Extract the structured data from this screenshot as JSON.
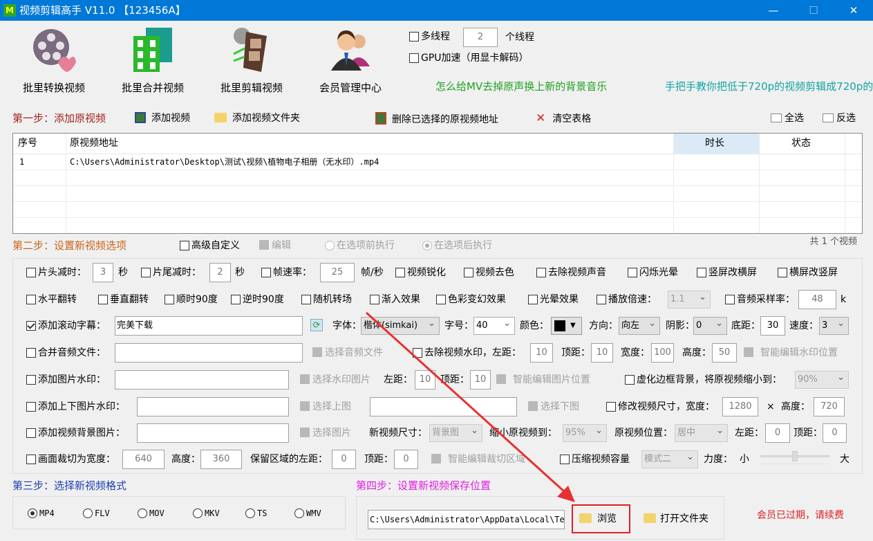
{
  "window": {
    "title": "视频剪辑高手 V11.0 【123456A】",
    "minimize": "—",
    "maximize": "☐",
    "close": "✕",
    "accent": "#0078d7"
  },
  "toolbar": {
    "items": [
      {
        "label": "批里转换视频",
        "icon": "film-reel-convert-icon"
      },
      {
        "label": "批里合并视频",
        "icon": "film-merge-icon"
      },
      {
        "label": "批里剪辑视频",
        "icon": "film-strip-cut-icon"
      },
      {
        "label": "会员管理中心",
        "icon": "users-icon"
      }
    ],
    "multithread_label": "多线程",
    "thread_count": "2",
    "thread_unit": "个线程",
    "gpu_label": "GPU加速（用显卡解码）",
    "link1": "怎么给MV去掉原声换上新的背景音乐",
    "link2": "手把手教你把低于720p的视频剪辑成720p的"
  },
  "step1": {
    "label": "第一步：添加原视频",
    "add_video": "添加视频",
    "add_folder": "添加视频文件夹",
    "delete_selected": "删除已选择的原视频地址",
    "clear": "清空表格",
    "select_all": "全选",
    "invert": "反选"
  },
  "table": {
    "columns": [
      "序号",
      "原视频地址",
      "时长",
      "状态"
    ],
    "rows": [
      {
        "index": "1",
        "path": "C:\\Users\\Administrator\\Desktop\\测试\\视频\\植物电子相册（无水印）.mp4",
        "duration": "",
        "status": ""
      }
    ]
  },
  "step2": {
    "label": "第二步：设置新视频选项",
    "advanced": "高级自定义",
    "edit": "编辑",
    "before": "在选项前执行",
    "after": "在选项后执行",
    "count": "共 1 个视频"
  },
  "opts": {
    "r1": {
      "head": "片头减时：",
      "head_v": "3",
      "sec": "秒",
      "tail": "片尾减时：",
      "tail_v": "2",
      "fps": "帧速率：",
      "fps_v": "25",
      "fps_unit": "帧/秒",
      "sharpen": "视频锐化",
      "decolor": "视频去色",
      "mute": "去除视频声音",
      "flash": "闪烁光晕",
      "v2h": "竖屏改横屏",
      "h2v": "横屏改竖屏"
    },
    "r2": {
      "hflip": "水平翻转",
      "vflip": "垂直翻转",
      "cw": "顺时90度",
      "ccw": "逆时90度",
      "trans": "随机转场",
      "fadein": "渐入效果",
      "color": "色彩变幻效果",
      "halo": "光晕效果",
      "speed": "播放倍速：",
      "speed_v": "1.1",
      "rate": "音频采样率：",
      "rate_v": "48",
      "rate_unit": "k"
    },
    "r3": {
      "scroll": "添加滚动字幕：",
      "scroll_v": "完美下载",
      "font": "字体：",
      "font_v": "楷体(simkai)",
      "size": "字号：",
      "size_v": "40",
      "color": "颜色：",
      "color_v": "#000000",
      "dir": "方向：",
      "dir_v": "向左",
      "shadow": "阴影：",
      "shadow_v": "0",
      "bottom": "底距：",
      "bottom_v": "30",
      "spd": "速度：",
      "spd_v": "3"
    },
    "r4": {
      "audio": "合并音频文件：",
      "audio_v": "",
      "pick_audio": "选择音频文件",
      "rmwm": "去除视频水印，左距：",
      "l_v": "10",
      "top": "顶距：",
      "t_v": "10",
      "w": "宽度：",
      "w_v": "100",
      "h": "高度：",
      "h_v": "50",
      "smart": "智能编辑水印位置"
    },
    "r5": {
      "imgwm": "添加图片水印：",
      "imgwm_v": "",
      "pick": "选择水印图片",
      "left": "左距：",
      "l_v": "10",
      "top": "顶距：",
      "t_v": "10",
      "smart": "智能编辑图片位置",
      "blur": "虚化边框背景，将原视频缩小到：",
      "blur_v": "90%"
    },
    "r6": {
      "tb": "添加上下图片水印：",
      "pick_top": "选择上图",
      "pick_bottom": "选择下图",
      "resize": "修改视频尺寸，宽度：",
      "w_v": "1280",
      "x": "×",
      "h": "高度：",
      "h_v": "720"
    },
    "r7": {
      "bg": "添加视频背景图片：",
      "pick": "选择图片",
      "newsize": "新视频尺寸：",
      "newsize_v": "背景图",
      "shrink": "缩小原视频到：",
      "shrink_v": "95%",
      "pos": "原视频位置：",
      "pos_v": "居中",
      "left": "左距：",
      "l_v": "0",
      "top": "顶距：",
      "t_v": "0"
    },
    "r8": {
      "crop": "画面裁切为宽度：",
      "w_v": "640",
      "h": "高度：",
      "h_v": "360",
      "keep": "保留区域的左距：",
      "l_v": "0",
      "top": "顶距：",
      "t_v": "0",
      "smart": "智能编辑裁切区域",
      "compress": "压缩视频容量",
      "mode_v": "模式二",
      "force": "力度：",
      "small": "小",
      "big": "大",
      "force_level": 0.5
    }
  },
  "step3": {
    "label": "第三步：选择新视频格式",
    "formats": [
      "MP4",
      "FLV",
      "MOV",
      "MKV",
      "TS",
      "WMV"
    ],
    "selected": "MP4"
  },
  "step4": {
    "label": "第四步：设置新视频保存位置",
    "path": "C:\\Users\\Administrator\\AppData\\Local\\Temp",
    "browse": "浏览",
    "open_folder": "打开文件夹"
  },
  "status": {
    "expired": "会员已过期，请续费"
  }
}
